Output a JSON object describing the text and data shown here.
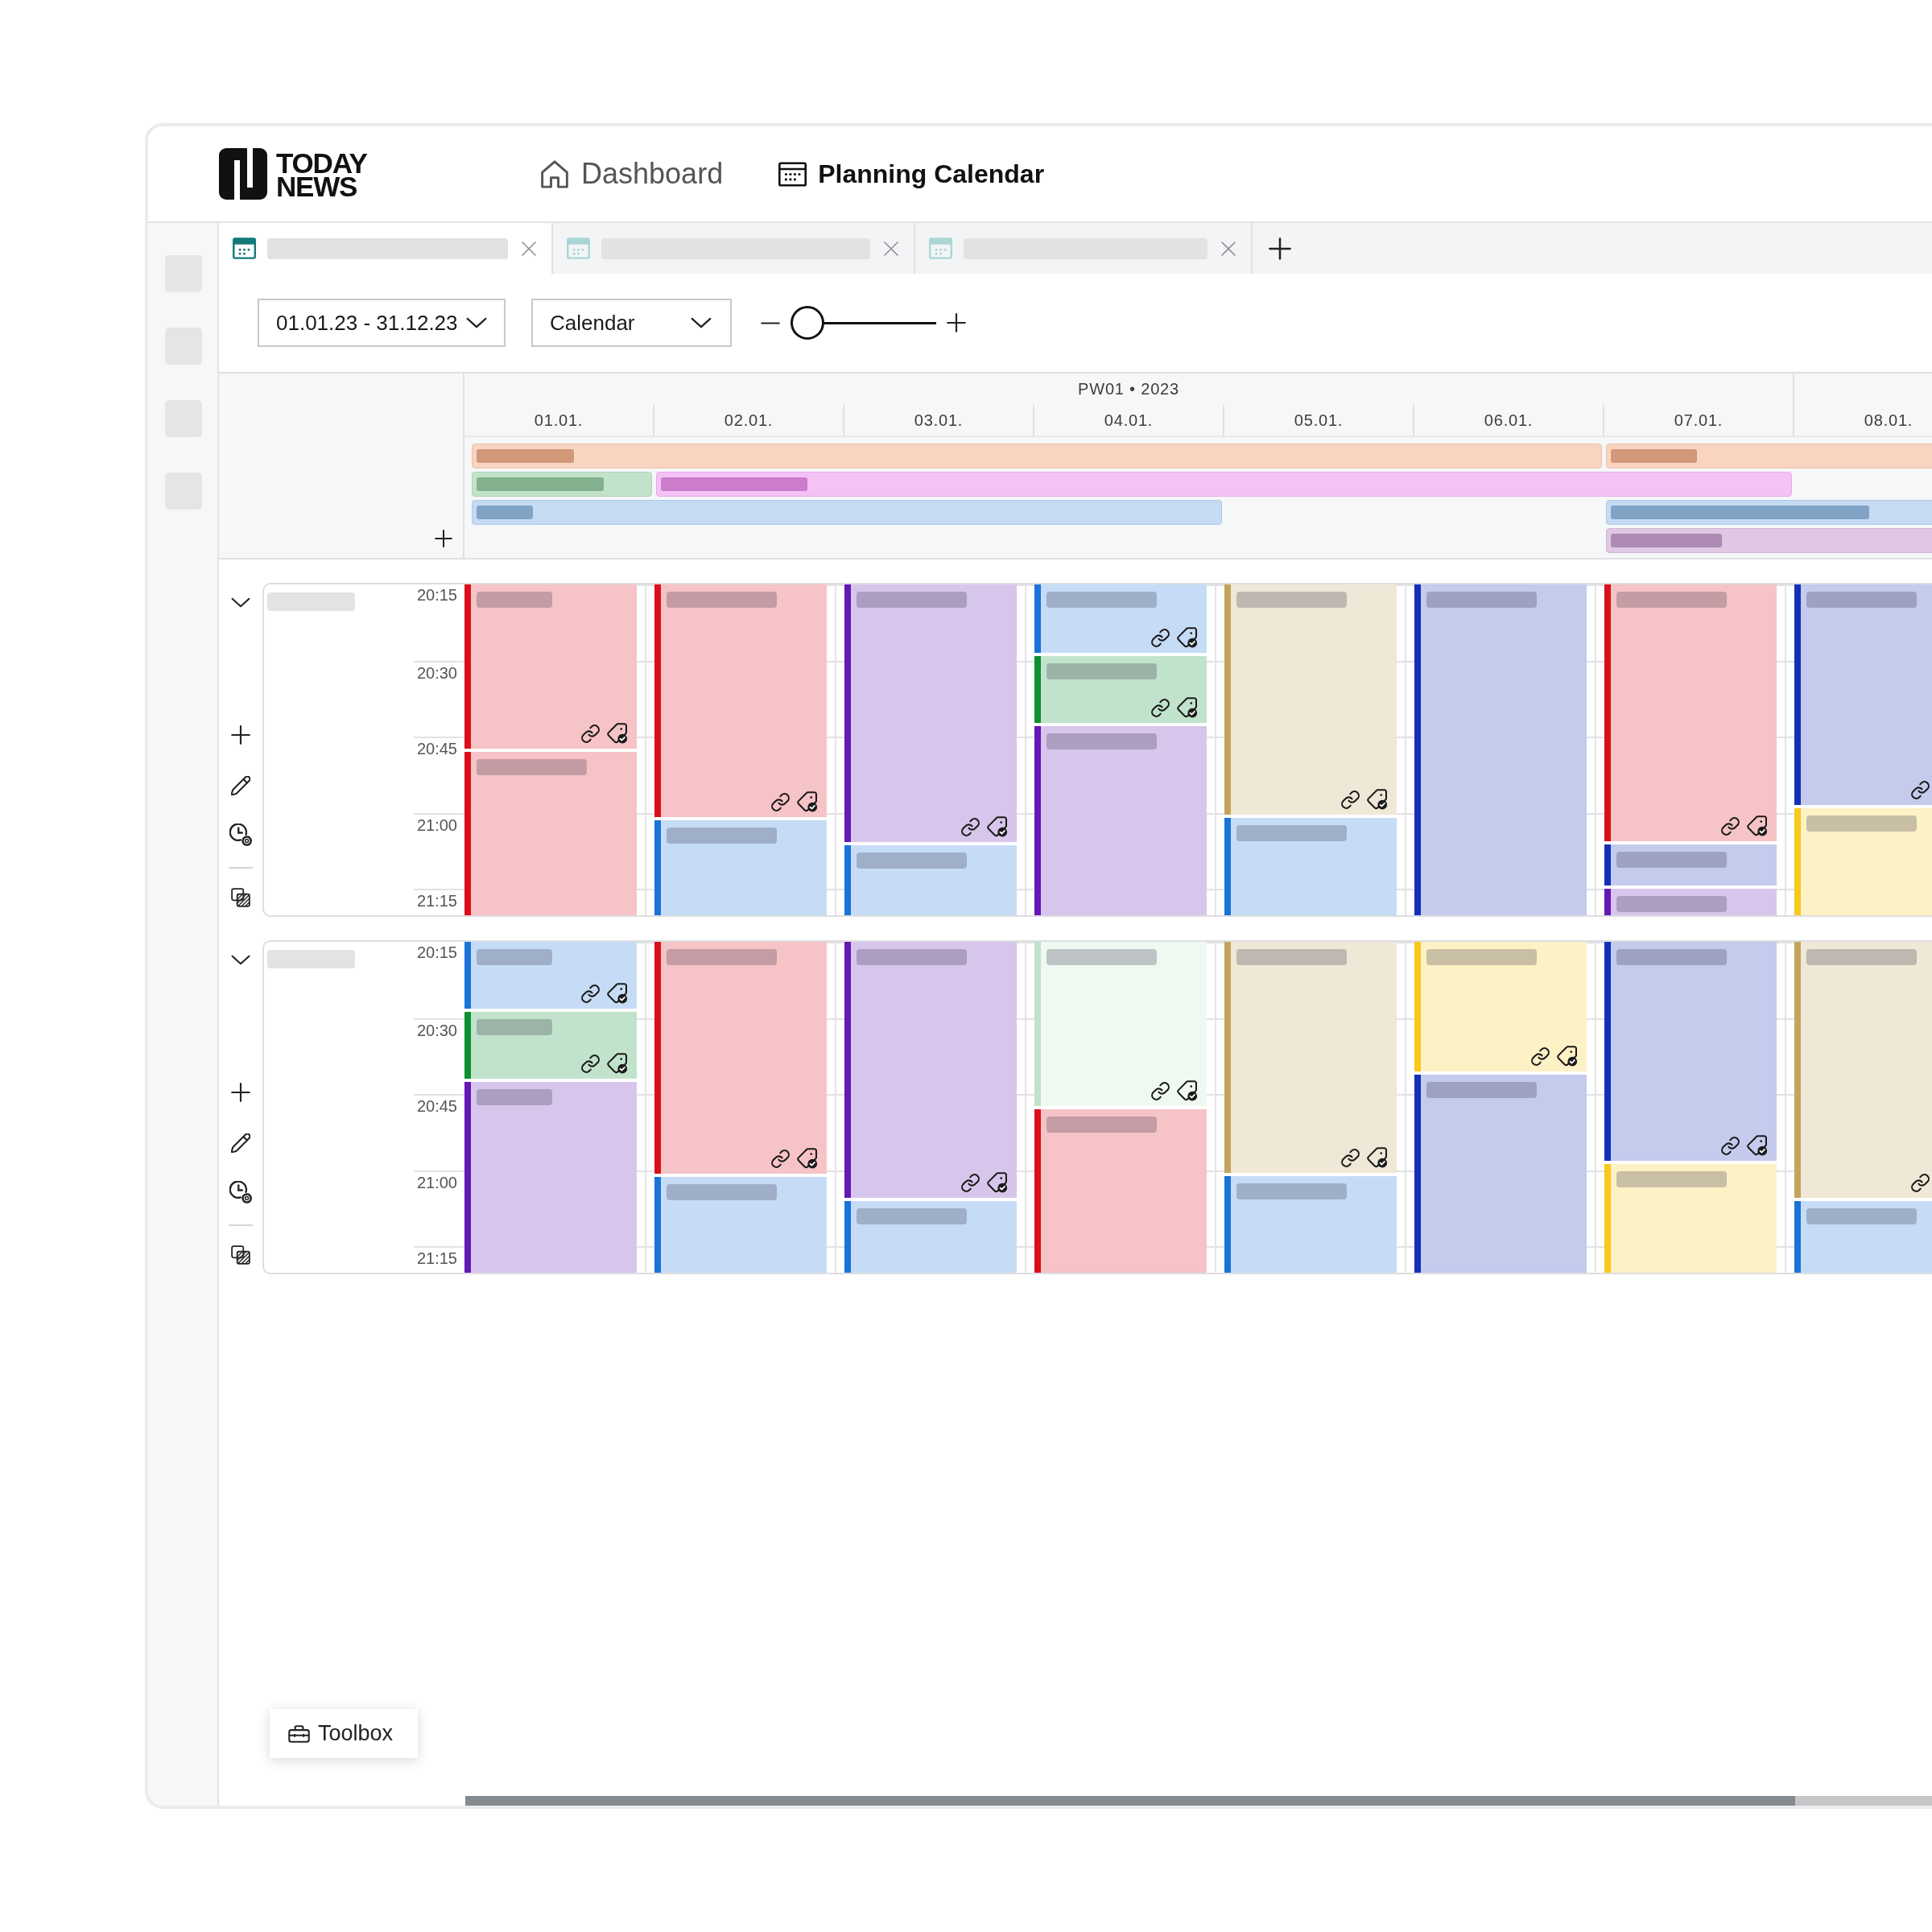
{
  "header": {
    "logo": "TODAY NEWS",
    "nav": [
      {
        "kind": "home",
        "label": "Dashboard",
        "selected": false
      },
      {
        "kind": "calendar",
        "label": "Planning Calendar",
        "selected": true
      }
    ]
  },
  "tabs": [
    {
      "selected": true
    },
    {
      "selected": false
    },
    {
      "selected": false
    }
  ],
  "toolbar": {
    "date_range": "01.01.23 - 31.12.23",
    "view": "Calendar",
    "zoom": {
      "level": 0
    }
  },
  "timeline": {
    "week": "PW01 • 2023",
    "days": [
      "01.01.",
      "02.01.",
      "03.01.",
      "04.01.",
      "05.01.",
      "06.01.",
      "07.01.",
      "08.01."
    ],
    "all_day_lanes": [
      {
        "bars": [
          {
            "color": "#f9d5c1"
          },
          {
            "color": "#f9d5c1"
          }
        ]
      },
      {
        "bars": [
          {
            "color": "#c2e3c9"
          },
          {
            "color": "#f5c2f5"
          }
        ]
      },
      {
        "bars": [
          {
            "color": "#c5dbf2"
          },
          {
            "color": "#c5dbf2"
          }
        ]
      },
      {
        "bars": [
          {
            "color": "#e0c8e4"
          }
        ]
      }
    ]
  },
  "groups": [
    {
      "expanded": true,
      "times": [
        "20:15",
        "20:30",
        "20:45",
        "21:00",
        "21:15"
      ],
      "days": [
        [
          {
            "color": "#d9101a",
            "linked": true,
            "tagged": true
          },
          {
            "color": "#d9101a",
            "linked": false,
            "tagged": false
          }
        ],
        [
          {
            "color": "#d9101a",
            "linked": true,
            "tagged": true
          },
          {
            "color": "#1a73d9",
            "linked": false,
            "tagged": false
          }
        ],
        [
          {
            "color": "#6418b4",
            "linked": true,
            "tagged": true
          },
          {
            "color": "#1a73d9",
            "linked": false,
            "tagged": false
          }
        ],
        [
          {
            "color": "#1a73d9",
            "linked": true,
            "tagged": true
          },
          {
            "color": "#0c9030",
            "linked": true,
            "tagged": true
          },
          {
            "color": "#6418b4",
            "linked": false,
            "tagged": false
          }
        ],
        [
          {
            "color": "#c4a45c",
            "linked": true,
            "tagged": true
          },
          {
            "color": "#1a73d9",
            "linked": false,
            "tagged": false
          }
        ],
        [
          {
            "color": "#1430b8",
            "linked": false,
            "tagged": false
          }
        ],
        [
          {
            "color": "#d9101a",
            "linked": true,
            "tagged": true
          },
          {
            "color": "#1430b8",
            "linked": false,
            "tagged": false
          },
          {
            "color": "#6418b4",
            "linked": false,
            "tagged": false
          }
        ],
        [
          {
            "color": "#1430b8",
            "linked": true,
            "tagged": false
          },
          {
            "color": "#f8c81c",
            "linked": false,
            "tagged": false
          }
        ]
      ]
    },
    {
      "expanded": true,
      "times": [
        "20:15",
        "20:30",
        "20:45",
        "21:00",
        "21:15"
      ],
      "days": [
        [
          {
            "color": "#1a73d9",
            "linked": true,
            "tagged": true
          },
          {
            "color": "#0c9030",
            "linked": true,
            "tagged": true
          },
          {
            "color": "#6418b4",
            "linked": false,
            "tagged": false
          }
        ],
        [
          {
            "color": "#d9101a",
            "linked": true,
            "tagged": true
          },
          {
            "color": "#1a73d9",
            "linked": false,
            "tagged": false
          }
        ],
        [
          {
            "color": "#6418b4",
            "linked": true,
            "tagged": true
          },
          {
            "color": "#1a73d9",
            "linked": false,
            "tagged": false
          }
        ],
        [
          {
            "color": "#c2e3c9",
            "linked": true,
            "tagged": true
          },
          {
            "color": "#d9101a",
            "linked": false,
            "tagged": false
          }
        ],
        [
          {
            "color": "#c4a45c",
            "linked": true,
            "tagged": true
          },
          {
            "color": "#1a73d9",
            "linked": false,
            "tagged": false
          }
        ],
        [
          {
            "color": "#f8c81c",
            "linked": true,
            "tagged": true
          },
          {
            "color": "#1430b8",
            "linked": false,
            "tagged": false
          }
        ],
        [
          {
            "color": "#1430b8",
            "linked": true,
            "tagged": true
          },
          {
            "color": "#f8c81c",
            "linked": false,
            "tagged": false
          }
        ],
        [
          {
            "color": "#c4a45c",
            "linked": true,
            "tagged": false
          },
          {
            "color": "#1a73d9",
            "linked": false,
            "tagged": false
          }
        ]
      ]
    }
  ],
  "toolbox": {
    "label": "Toolbox"
  }
}
